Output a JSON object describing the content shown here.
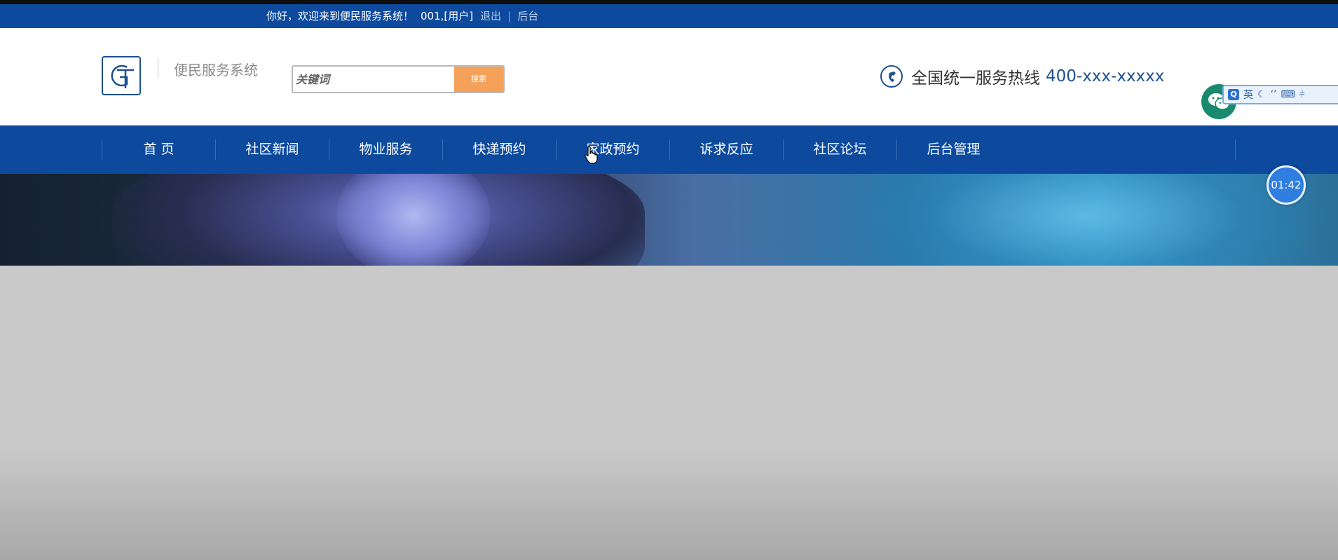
{
  "topbar": {
    "greeting": "你好，欢迎来到便民服务系统！",
    "user": "001,[用户]",
    "logout": "退出",
    "separator": "|",
    "admin": "后台"
  },
  "header": {
    "site_name": "便民服务系统",
    "search": {
      "placeholder": "关键词",
      "button": "搜索"
    },
    "hotline": {
      "label": "全国统一服务热线",
      "number": "400-xxx-xxxxx"
    }
  },
  "nav": {
    "items": [
      {
        "label": "首 页"
      },
      {
        "label": "社区新闻"
      },
      {
        "label": "物业服务"
      },
      {
        "label": "快递预约"
      },
      {
        "label": "家政预约"
      },
      {
        "label": "诉求反应"
      },
      {
        "label": "社区论坛"
      },
      {
        "label": "后台管理"
      }
    ]
  },
  "ime": {
    "mode": "英"
  },
  "timer": {
    "text": "01:42"
  },
  "colors": {
    "brand": "#0d4a9e",
    "search_button": "#f6a15a",
    "wechat": "#1a8a6e",
    "timer": "#2f7ee0"
  }
}
